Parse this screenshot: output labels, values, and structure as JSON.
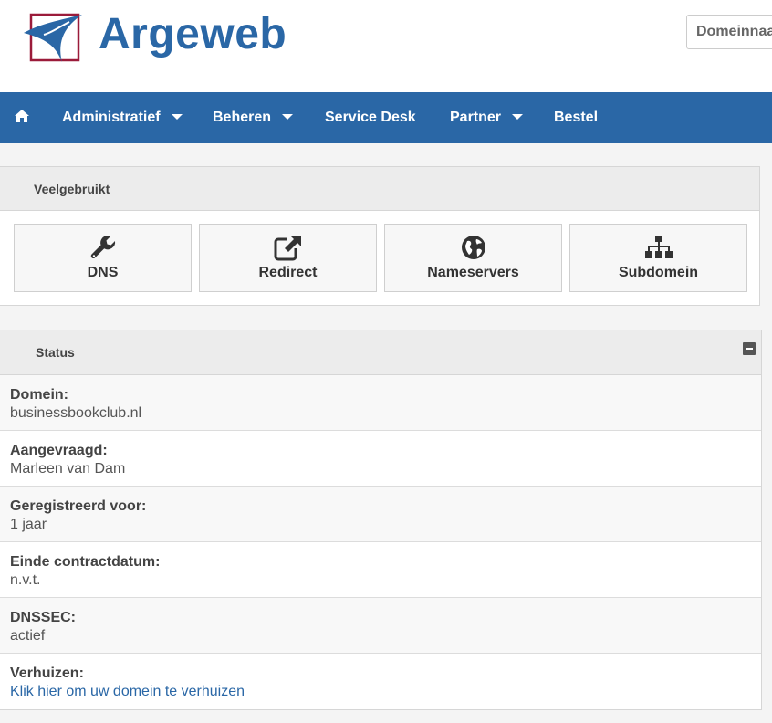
{
  "header": {
    "logo_text": "Argeweb",
    "search_placeholder": "Domeinnaam",
    "brand_color": "#2a67a6"
  },
  "nav": {
    "home_icon": "home-icon",
    "items": [
      {
        "label": "Administratief",
        "dropdown": true
      },
      {
        "label": "Beheren",
        "dropdown": true
      },
      {
        "label": "Service Desk",
        "dropdown": false
      },
      {
        "label": "Partner",
        "dropdown": true
      },
      {
        "label": "Bestel",
        "dropdown": false
      }
    ]
  },
  "veelgebruikt": {
    "title": "Veelgebruikt",
    "buttons": [
      {
        "label": "DNS",
        "icon": "wrench-icon"
      },
      {
        "label": "Redirect",
        "icon": "external-link-icon"
      },
      {
        "label": "Nameservers",
        "icon": "globe-icon"
      },
      {
        "label": "Subdomein",
        "icon": "sitemap-icon"
      }
    ]
  },
  "status": {
    "title": "Status",
    "rows": [
      {
        "key": "Domein:",
        "value": "businessbookclub.nl"
      },
      {
        "key": "Aangevraagd:",
        "value": "Marleen van Dam"
      },
      {
        "key": "Geregistreerd voor:",
        "value": "1 jaar"
      },
      {
        "key": "Einde contractdatum:",
        "value": "n.v.t."
      },
      {
        "key": "DNSSEC:",
        "value": "actief"
      },
      {
        "key": "Verhuizen:",
        "value": "Klik hier om uw domein te verhuizen"
      }
    ]
  }
}
